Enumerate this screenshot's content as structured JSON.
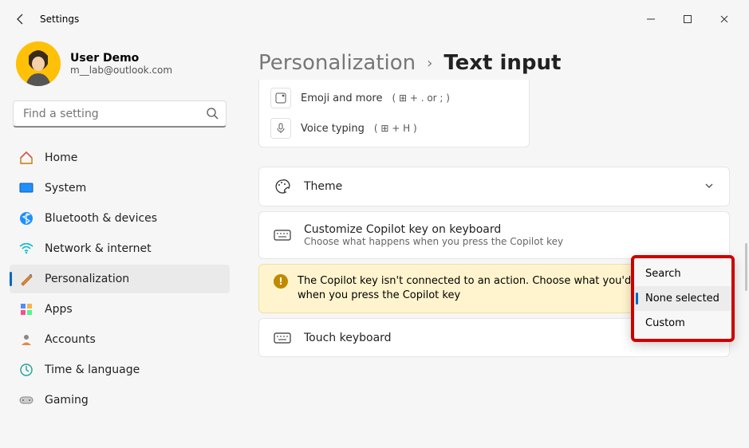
{
  "window": {
    "title": "Settings"
  },
  "user": {
    "name": "User Demo",
    "email": "m__lab@outlook.com"
  },
  "search": {
    "placeholder": "Find a setting"
  },
  "nav": {
    "items": [
      {
        "label": "Home"
      },
      {
        "label": "System"
      },
      {
        "label": "Bluetooth & devices"
      },
      {
        "label": "Network & internet"
      },
      {
        "label": "Personalization"
      },
      {
        "label": "Apps"
      },
      {
        "label": "Accounts"
      },
      {
        "label": "Time & language"
      },
      {
        "label": "Gaming"
      }
    ]
  },
  "breadcrumb": {
    "parent": "Personalization",
    "current": "Text input"
  },
  "quick": {
    "emoji_label": "Emoji and more",
    "emoji_short": "( ⊞ + . or ; )",
    "voice_label": "Voice typing",
    "voice_short": "( ⊞ + H )"
  },
  "settings": {
    "theme": {
      "title": "Theme"
    },
    "copilot": {
      "title": "Customize Copilot key on keyboard",
      "subtitle": "Choose what happens when you press the Copilot key"
    },
    "warning": "The Copilot key isn't connected to an action. Choose what you'd like to happen when you press the Copilot key",
    "touch": {
      "title": "Touch keyboard"
    }
  },
  "dropdown": {
    "options": [
      {
        "label": "Search"
      },
      {
        "label": "None selected",
        "selected": true
      },
      {
        "label": "Custom"
      }
    ]
  }
}
